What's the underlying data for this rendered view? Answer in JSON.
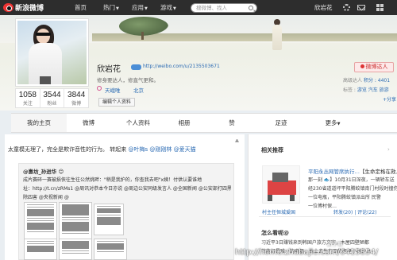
{
  "nav": {
    "logo_text": "新浪微博",
    "items": [
      {
        "label": "首页",
        "caret": false
      },
      {
        "label": "热门",
        "caret": true
      },
      {
        "label": "应用",
        "caret": true
      },
      {
        "label": "游戏",
        "caret": true
      }
    ],
    "search_placeholder": "搜微博、找人",
    "user_name": "欣岩花"
  },
  "profile": {
    "name": "欣岩花",
    "url": "http://weibo.com/u/2135503671",
    "bio": "修身要达人，修直气更和。",
    "location1": "天峨唯",
    "location2": "北京",
    "edit_label": "编辑个人资料",
    "follow_label": "微博达人",
    "level_label": "高级达人",
    "level_value": "积分 : 4401",
    "tags_label": "标签 :",
    "tags_value": "游览 汽车 旅游",
    "tags_more": "+分享",
    "stats": [
      {
        "num": "1058",
        "label": "关注"
      },
      {
        "num": "3544",
        "label": "粉丝"
      },
      {
        "num": "3844",
        "label": "微博"
      }
    ]
  },
  "tabs": [
    {
      "label": "我的主页",
      "caret": false
    },
    {
      "label": "微博",
      "caret": false
    },
    {
      "label": "个人资料",
      "caret": false
    },
    {
      "label": "相册",
      "caret": false
    },
    {
      "label": "赞",
      "caret": false
    },
    {
      "label": "足迹",
      "caret": false
    },
    {
      "label": "更多",
      "caret": true
    }
  ],
  "feed": {
    "post_text": "太童模无理了，完全是欺诈音性的行为。",
    "repost_prefix": "转起来",
    "mentions": "@叶梅s @刚刚林 @爱天猫",
    "repost": {
      "author": "@惠坊_孙进华 😊",
      "lines": [
        "成片赛碎一赛被损侠往生往公然挑畔：\"稍是我护的，你查我去吧\"x姨！付供认要谁地",
        "址：http://t.cn/zRMs1 @周讯对恭本今日亦说 @周边公安同级发言人 @全国新闻 @公安部打四黑",
        "除四害 @央视新闻 @"
      ]
    }
  },
  "sidebar": {
    "title": "相关推荐",
    "rec_title": "平阳永丛网管席执行…",
    "rec_title_tail": "【生命定格在救人",
    "rec_lines": [
      "那一刻 🐟】10月31日深夜，一辆轿车送",
      "经230省道道坪平阳腾蛟镇南门村段时撞伤",
      "一位电瓶，平阳腾蛟镇派出所 民警",
      "一位傅村保…"
    ],
    "rec_foot_user": "村主任恒城爱国",
    "rec_foot_stats": "转发(20) | 评论(22)",
    "title2": "怎么看呢@",
    "side_lines": [
      "习近平3日赚钱来到韩国户旅方文字，木屋四壁陋都",
      "节能灯是唯一的电器，本土去生在四的老屋小村外来"
    ]
  },
  "watermark": {
    "text": "http://home.zhubajie.com/6415854/",
    "corner": "新宁蜀"
  },
  "colors": {
    "topbar": "#2d2d2d",
    "link": "#2a6ab3",
    "follow": "#c33"
  }
}
